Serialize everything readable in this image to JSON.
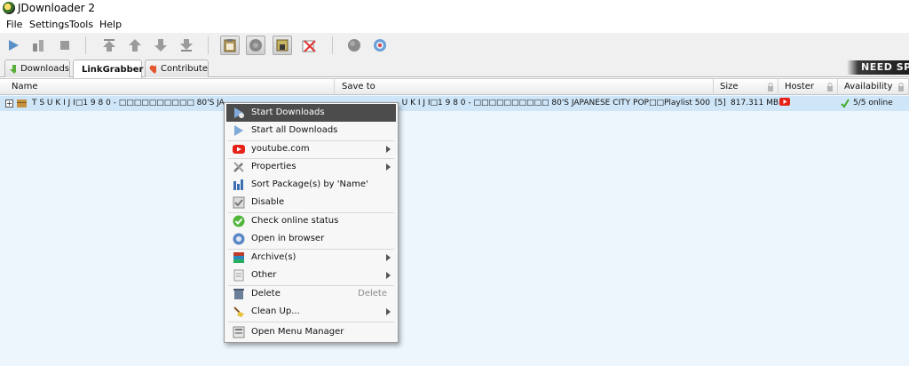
{
  "window": {
    "title": "JDownloader 2"
  },
  "menubar": {
    "items": [
      "File",
      "Settings",
      "Tools",
      "Help"
    ]
  },
  "toolbar": {
    "buttons": [
      "play-icon",
      "pause-icon",
      "stop-icon",
      "move-top-icon",
      "move-up-icon",
      "move-down-icon",
      "move-bottom-icon",
      "clipboard-observer-icon",
      "auto-reconnect-icon",
      "premium-lock-icon",
      "silent-mode-icon",
      "reconnect-icon",
      "update-icon"
    ]
  },
  "tabs": [
    {
      "label": "Downloads",
      "icon": "download-arrow-icon"
    },
    {
      "label": "LinkGrabber",
      "icon": "linkgrabber-icon"
    },
    {
      "label": "Contribute",
      "icon": "heart-icon"
    }
  ],
  "banner": {
    "text": "NEED SPE"
  },
  "table": {
    "columns": {
      "name": "Name",
      "save_to": "Save to",
      "size": "Size",
      "hoster": "Hoster",
      "availability": "Availability"
    },
    "rows": [
      {
        "expand": "+",
        "name": "T S U K I J I□1 9 8 0 - □□□□□□□□□□ 80'S JAPANESE CITY POP□□Playlist 500",
        "save_to": "C:\\Users\\Downloads\\T S U K I J I□1 9 8 0 - □□□□□□□□□□ 80'S JAPANESE CITY POP□□Playlist 500",
        "count": "[5]",
        "size": "817.311 MB",
        "hoster_icon": "youtube-icon",
        "availability": "5/5 online"
      }
    ]
  },
  "context_menu": {
    "items": [
      {
        "label": "Start Downloads",
        "icon": "start-downloads-icon",
        "highlighted": true
      },
      {
        "label": "Start all Downloads",
        "icon": "start-all-icon"
      },
      {
        "label": "youtube.com",
        "icon": "youtube-icon",
        "submenu": true
      },
      {
        "label": "Properties",
        "icon": "wrench-icon",
        "submenu": true
      },
      {
        "label": "Sort Package(s) by 'Name'",
        "icon": "sort-icon"
      },
      {
        "label": "Disable",
        "icon": "disable-icon"
      },
      {
        "label": "Check online status",
        "icon": "check-icon"
      },
      {
        "label": "Open in browser",
        "icon": "browser-icon"
      },
      {
        "label": "Archive(s)",
        "icon": "archive-icon",
        "submenu": true
      },
      {
        "label": "Other",
        "icon": "other-icon",
        "submenu": true
      },
      {
        "label": "Delete",
        "icon": "delete-icon",
        "shortcut": "Delete"
      },
      {
        "label": "Clean Up...",
        "icon": "broom-icon",
        "submenu": true
      },
      {
        "label": "Open Menu Manager",
        "icon": "menu-manager-icon"
      }
    ]
  },
  "colors": {
    "row_selected": "#cfe6f8",
    "table_bg": "#edf6fd",
    "menu_highlight": "#4c4c4c",
    "accent_youtube": "#e62117",
    "accent_green": "#3fae29"
  }
}
